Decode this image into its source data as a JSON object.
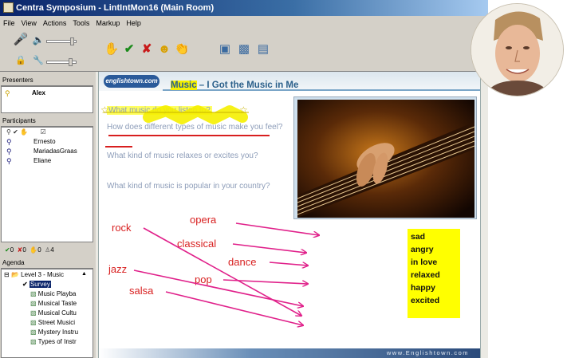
{
  "window": {
    "title": "Centra Symposium - LintIntMon16 (Main Room)"
  },
  "menu": [
    "File",
    "View",
    "Actions",
    "Tools",
    "Markup",
    "Help"
  ],
  "presenters": {
    "header": "Presenters",
    "names": [
      "Alex"
    ]
  },
  "participants": {
    "header": "Participants",
    "names": [
      "Ernesto",
      "MariadasGraas",
      "Eliane"
    ]
  },
  "feedback": {
    "yes": "0",
    "no": "0",
    "hand": "0",
    "people": "4"
  },
  "agenda": {
    "header": "Agenda",
    "folder": "Level 3 - Music",
    "items": [
      "Survey",
      "Music Playba",
      "Musical Taste",
      "Musical Cultu",
      "Street Musici",
      "Mystery Instru",
      "Types of Instr"
    ]
  },
  "slide": {
    "logo": "englishtown.com",
    "title_highlight": "Music",
    "title_rest": " – I Got the Music in Me",
    "questions": [
      "What music do you listen to?",
      "How does different types of music make you feel?",
      "What kind of music relaxes or excites you?",
      "What kind of music is popular in your country?"
    ],
    "genres": [
      "opera",
      "rock",
      "classical",
      "dance",
      "jazz",
      "pop",
      "salsa"
    ],
    "feelings": [
      "sad",
      "angry",
      "in love",
      "relaxed",
      "happy",
      "excited"
    ],
    "footer": "www.Englishtown.com"
  },
  "colors": {
    "accent": "#0a246a",
    "markup_red": "#d81f1f",
    "markup_pink": "#e0208a",
    "highlight": "#ffff00"
  },
  "icons": [
    "hand-raise-icon",
    "check-icon",
    "cross-icon",
    "laugh-icon",
    "applause-icon",
    "whiteboard-icon",
    "app-share-icon",
    "poll-icon"
  ]
}
